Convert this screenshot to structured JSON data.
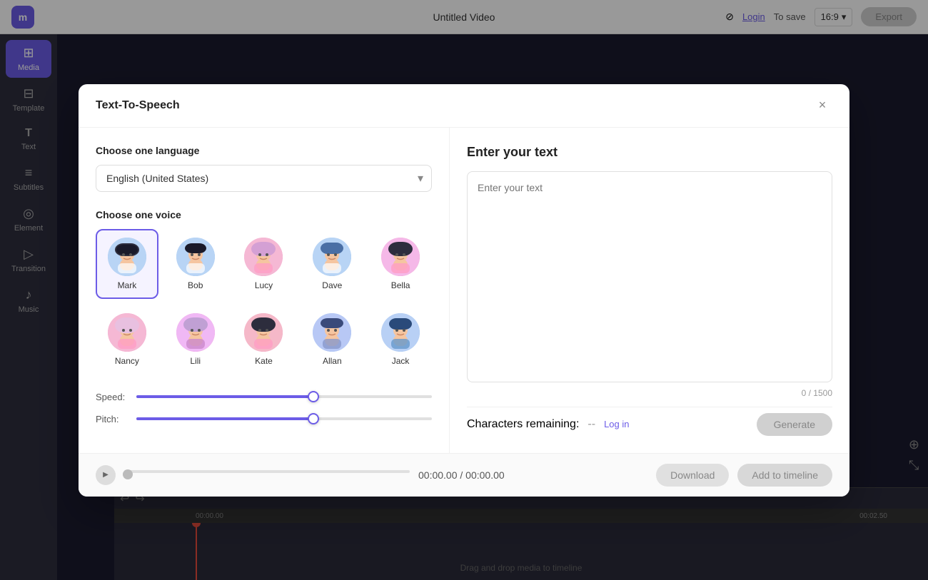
{
  "app": {
    "logo": "m",
    "title": "Untitled Video",
    "login_label": "Login",
    "to_save": "To save",
    "ratio": "16:9",
    "export_label": "Export"
  },
  "sidebar": {
    "items": [
      {
        "id": "media",
        "label": "Media",
        "icon": "⊞",
        "active": true
      },
      {
        "id": "template",
        "label": "Template",
        "icon": "⊟"
      },
      {
        "id": "text",
        "label": "Text",
        "icon": "T"
      },
      {
        "id": "subtitles",
        "label": "Subtitles",
        "icon": "≡"
      },
      {
        "id": "element",
        "label": "Element",
        "icon": "◎"
      },
      {
        "id": "transition",
        "label": "Transition",
        "icon": "▶"
      },
      {
        "id": "music",
        "label": "Music",
        "icon": "♪"
      }
    ]
  },
  "modal": {
    "title": "Text-To-Speech",
    "close_label": "×",
    "left": {
      "language_section": "Choose one language",
      "language_value": "English (United States)",
      "voice_section": "Choose one voice",
      "voices": [
        {
          "id": "mark",
          "name": "Mark",
          "selected": true,
          "gender": "male",
          "color1": "#b8d4f5",
          "color2": "#7bb3e8",
          "hair": "dark"
        },
        {
          "id": "bob",
          "name": "Bob",
          "selected": false,
          "gender": "male",
          "color1": "#b8d4f5",
          "color2": "#7bb3e8",
          "hair": "dark"
        },
        {
          "id": "lucy",
          "name": "Lucy",
          "selected": false,
          "gender": "female",
          "color1": "#f5b8d4",
          "color2": "#e87bb3",
          "hair": "light"
        },
        {
          "id": "dave",
          "name": "Dave",
          "selected": false,
          "gender": "male",
          "color1": "#b8d4f5",
          "color2": "#7bb3e8",
          "hair": "dark"
        },
        {
          "id": "bella",
          "name": "Bella",
          "selected": false,
          "gender": "female",
          "color1": "#f5b8d4",
          "color2": "#e87bb3",
          "hair": "dark"
        },
        {
          "id": "nancy",
          "name": "Nancy",
          "selected": false,
          "gender": "female",
          "color1": "#f5b8d4",
          "color2": "#e87bb3",
          "hair": "light"
        },
        {
          "id": "lili",
          "name": "Lili",
          "selected": false,
          "gender": "female",
          "color1": "#f5b8e8",
          "color2": "#e87bb3",
          "hair": "light"
        },
        {
          "id": "kate",
          "name": "Kate",
          "selected": false,
          "gender": "female",
          "color1": "#f5b8d4",
          "color2": "#e87bb3",
          "hair": "dark"
        },
        {
          "id": "allan",
          "name": "Allan",
          "selected": false,
          "gender": "male",
          "color1": "#b8d4f5",
          "color2": "#7bb3e8",
          "hair": "dark"
        },
        {
          "id": "jack",
          "name": "Jack",
          "selected": false,
          "gender": "male",
          "color1": "#b8cff5",
          "color2": "#7bb3e8",
          "hair": "dark"
        }
      ],
      "speed_label": "Speed:",
      "pitch_label": "Pitch:",
      "speed_value": 60,
      "pitch_value": 60
    },
    "right": {
      "title": "Enter your text",
      "placeholder": "Enter your text",
      "char_count": "0 / 1500",
      "characters_remaining_label": "Characters remaining:",
      "dashes": "--",
      "log_in_label": "Log in",
      "generate_label": "Generate"
    },
    "footer": {
      "time_display": "00:00.00 / 00:00.00",
      "download_label": "Download",
      "add_timeline_label": "Add to timeline"
    }
  },
  "timeline": {
    "time_start": "00:00.00",
    "drag_drop_text": "Drag and drop media to timeline",
    "undo_icon": "↩",
    "redo_icon": "↪"
  }
}
